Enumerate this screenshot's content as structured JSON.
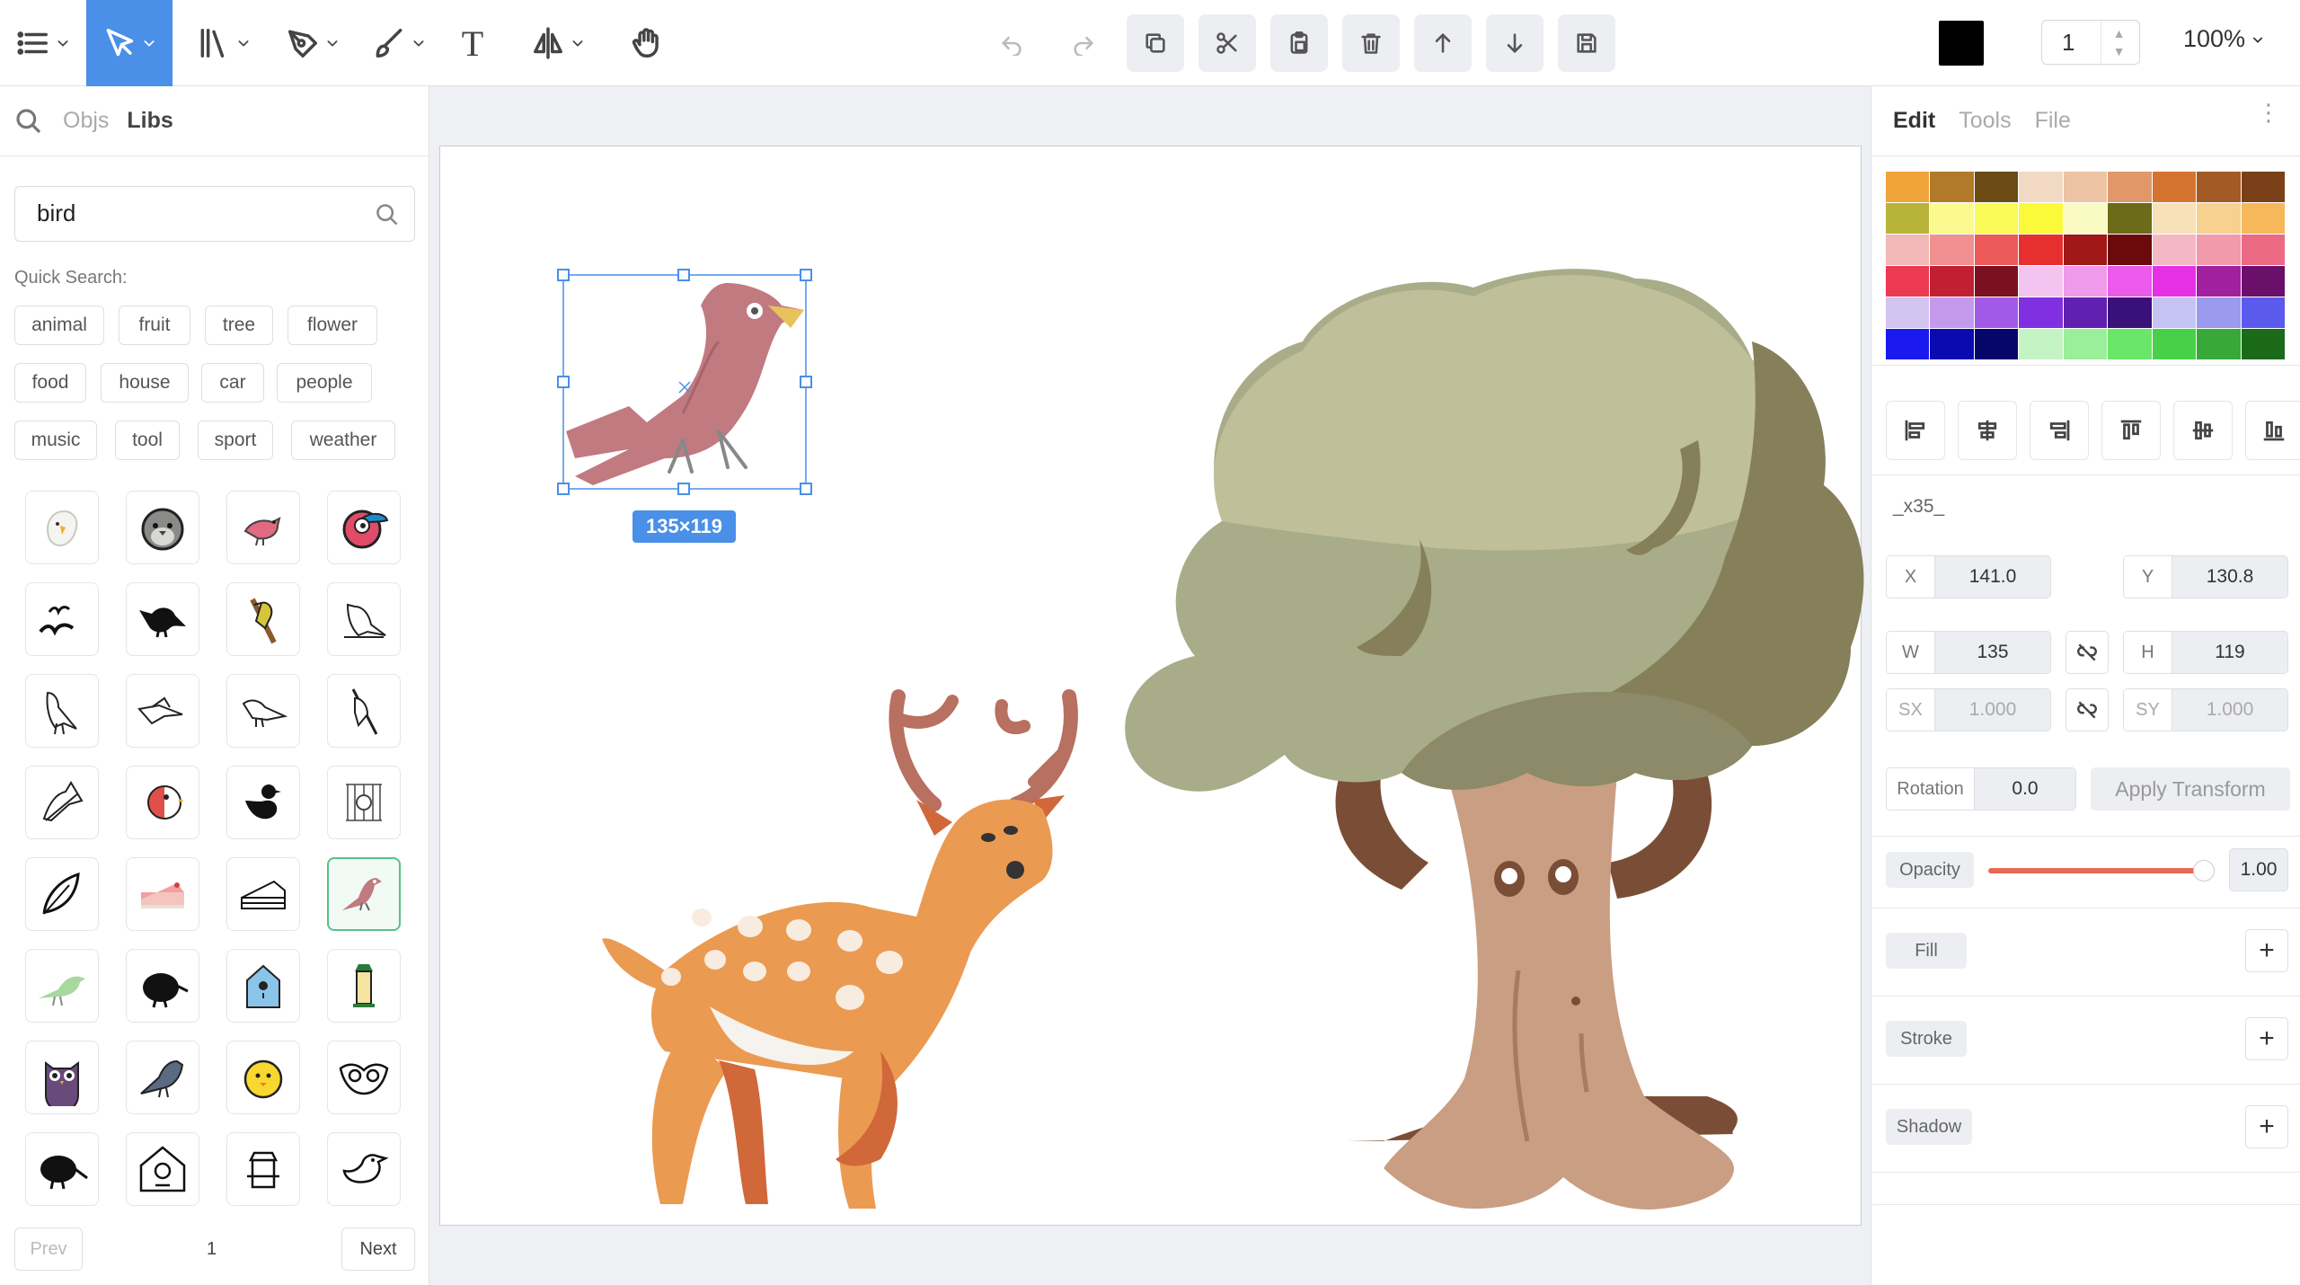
{
  "toolbar": {
    "text_tool_glyph": "T",
    "stroke_width": "1",
    "zoom": "100%",
    "fill_color": "#000000",
    "accent": "#4a8fe8"
  },
  "left_panel": {
    "tabs": [
      "Objs",
      "Libs"
    ],
    "active_tab": "Libs",
    "search_value": "bird",
    "quick_search_label": "Quick Search:",
    "quick_tags": [
      "animal",
      "fruit",
      "tree",
      "flower",
      "food",
      "house",
      "car",
      "people",
      "music",
      "tool",
      "sport",
      "weather"
    ],
    "pager": {
      "prev": "Prev",
      "page": "1",
      "next": "Next"
    }
  },
  "canvas": {
    "selection_size": "135×119"
  },
  "right_panel": {
    "tabs": [
      "Edit",
      "Tools",
      "File"
    ],
    "active_tab": "Edit",
    "palette": [
      "#f0a43a",
      "#b07a2a",
      "#6b4a14",
      "#f2d9c4",
      "#ecc4a4",
      "#e0986a",
      "#d47430",
      "#a35a24",
      "#7a4018",
      "#b8b43a",
      "#fafa90",
      "#fafa58",
      "#fafa3a",
      "#fafac4",
      "#6b6b1a",
      "#f8e0b8",
      "#f8d090",
      "#f6b85a",
      "#f2b8b8",
      "#f09090",
      "#ec5a5a",
      "#e63030",
      "#a01818",
      "#6a0a0a",
      "#f4b8c4",
      "#f09aac",
      "#ec6a84",
      "#ec3a52",
      "#c02032",
      "#7a1020",
      "#f4c4f0",
      "#f09aec",
      "#ec5aec",
      "#e630e6",
      "#a020a0",
      "#6a106a",
      "#d4c4f0",
      "#c49aec",
      "#a25ae6",
      "#8030e0",
      "#6020b0",
      "#3a107a",
      "#c4c4f4",
      "#9a9aef",
      "#5a5aec",
      "#1a1af0",
      "#0a0ab0",
      "#06066a",
      "#c4f4c4",
      "#9aef9a",
      "#6ae66a",
      "#48d048",
      "#38a838",
      "#1a6a1a"
    ],
    "object_name": "_x35_",
    "x": "141.0",
    "y": "130.8",
    "w": "135",
    "h": "119",
    "sx": "1.000",
    "sy": "1.000",
    "rotation": "0.0",
    "apply_label": "Apply Transform",
    "opacity_label": "Opacity",
    "opacity": "1.00",
    "opacity_level": 0.96,
    "fill_label": "Fill",
    "stroke_label": "Stroke",
    "shadow_label": "Shadow",
    "field_labels": {
      "x": "X",
      "y": "Y",
      "w": "W",
      "h": "H",
      "sx": "SX",
      "sy": "SY",
      "rotation": "Rotation"
    }
  }
}
